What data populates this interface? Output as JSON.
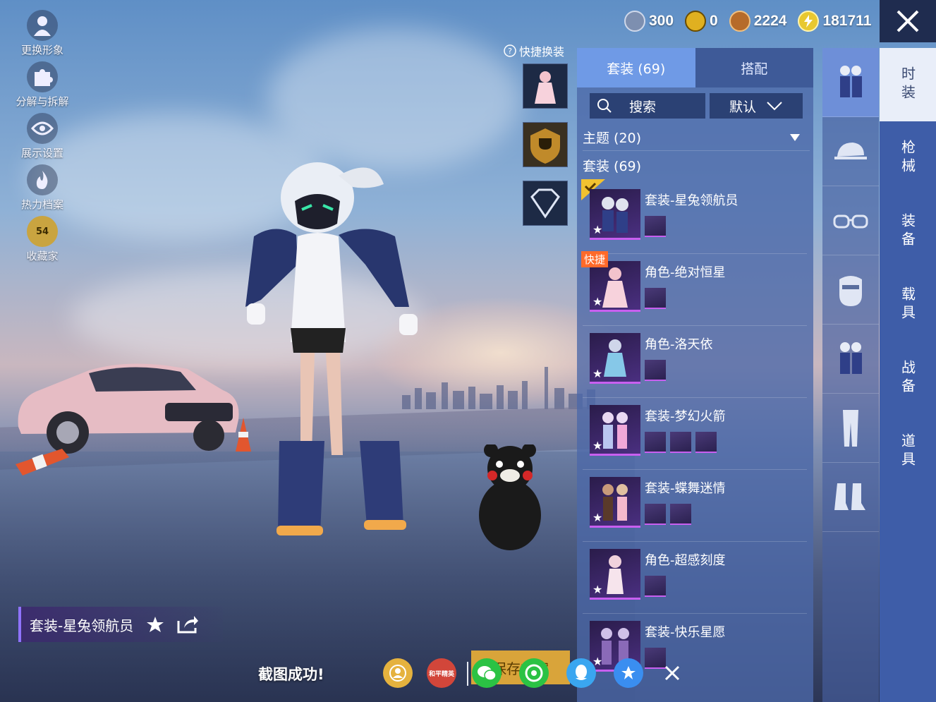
{
  "side_menu": [
    {
      "label": "更换形象",
      "icon": "person-icon"
    },
    {
      "label": "分解与拆解",
      "icon": "puzzle-icon"
    },
    {
      "label": "展示设置",
      "icon": "eye-icon"
    },
    {
      "label": "热力档案",
      "icon": "flame-icon"
    },
    {
      "label": "收藏家",
      "icon": "collector-badge-icon",
      "badge": "54"
    }
  ],
  "currencies": [
    {
      "name": "silver",
      "value": "300",
      "color": "#7d8fb0"
    },
    {
      "name": "bp",
      "value": "0",
      "color": "#e0b020"
    },
    {
      "name": "coupon",
      "value": "2224",
      "color": "#b66b2a"
    },
    {
      "name": "energy",
      "value": "181711",
      "color": "#e8c830"
    }
  ],
  "quick_swap": {
    "label": "快捷换装"
  },
  "panel": {
    "tabs": [
      {
        "label": "套装 (69)",
        "active": true
      },
      {
        "label": "搭配",
        "active": false
      }
    ],
    "search_label": "搜索",
    "sort_label": "默认",
    "theme_section": "主题 (20)",
    "suit_section": "套装 (69)",
    "items": [
      {
        "name": "套装-星兔领航员",
        "equipped": true,
        "quick": false,
        "sub_count": 1
      },
      {
        "name": "角色-绝对恒星",
        "equipped": false,
        "quick": true,
        "quick_label": "快捷",
        "sub_count": 1
      },
      {
        "name": "角色-洛天依",
        "equipped": false,
        "quick": false,
        "sub_count": 1
      },
      {
        "name": "套装-梦幻火箭",
        "equipped": false,
        "quick": false,
        "sub_count": 3
      },
      {
        "name": "套装-蝶舞迷情",
        "equipped": false,
        "quick": false,
        "sub_count": 2
      },
      {
        "name": "角色-超感刻度",
        "equipped": false,
        "quick": false,
        "sub_count": 1
      },
      {
        "name": "套装-快乐星愿",
        "equipped": false,
        "quick": false,
        "sub_count": 1
      }
    ]
  },
  "categories": [
    {
      "icon": "outfit-icon",
      "active": true
    },
    {
      "icon": "cap-icon",
      "active": false
    },
    {
      "icon": "glasses-icon",
      "active": false
    },
    {
      "icon": "mask-icon",
      "active": false
    },
    {
      "icon": "outfit-alt-icon",
      "active": false
    },
    {
      "icon": "pants-icon",
      "active": false
    },
    {
      "icon": "boots-icon",
      "active": false
    }
  ],
  "types": [
    {
      "label": "时装",
      "active": true
    },
    {
      "label": "枪械",
      "active": false
    },
    {
      "label": "装备",
      "active": false
    },
    {
      "label": "载具",
      "active": false
    },
    {
      "label": "战备",
      "active": false
    },
    {
      "label": "道具",
      "active": false
    }
  ],
  "bottom": {
    "current_outfit": "套装-星兔领航员",
    "toast": "截图成功!",
    "save_label": "保存方案",
    "share_labels": {
      "game": "和平精英"
    }
  }
}
